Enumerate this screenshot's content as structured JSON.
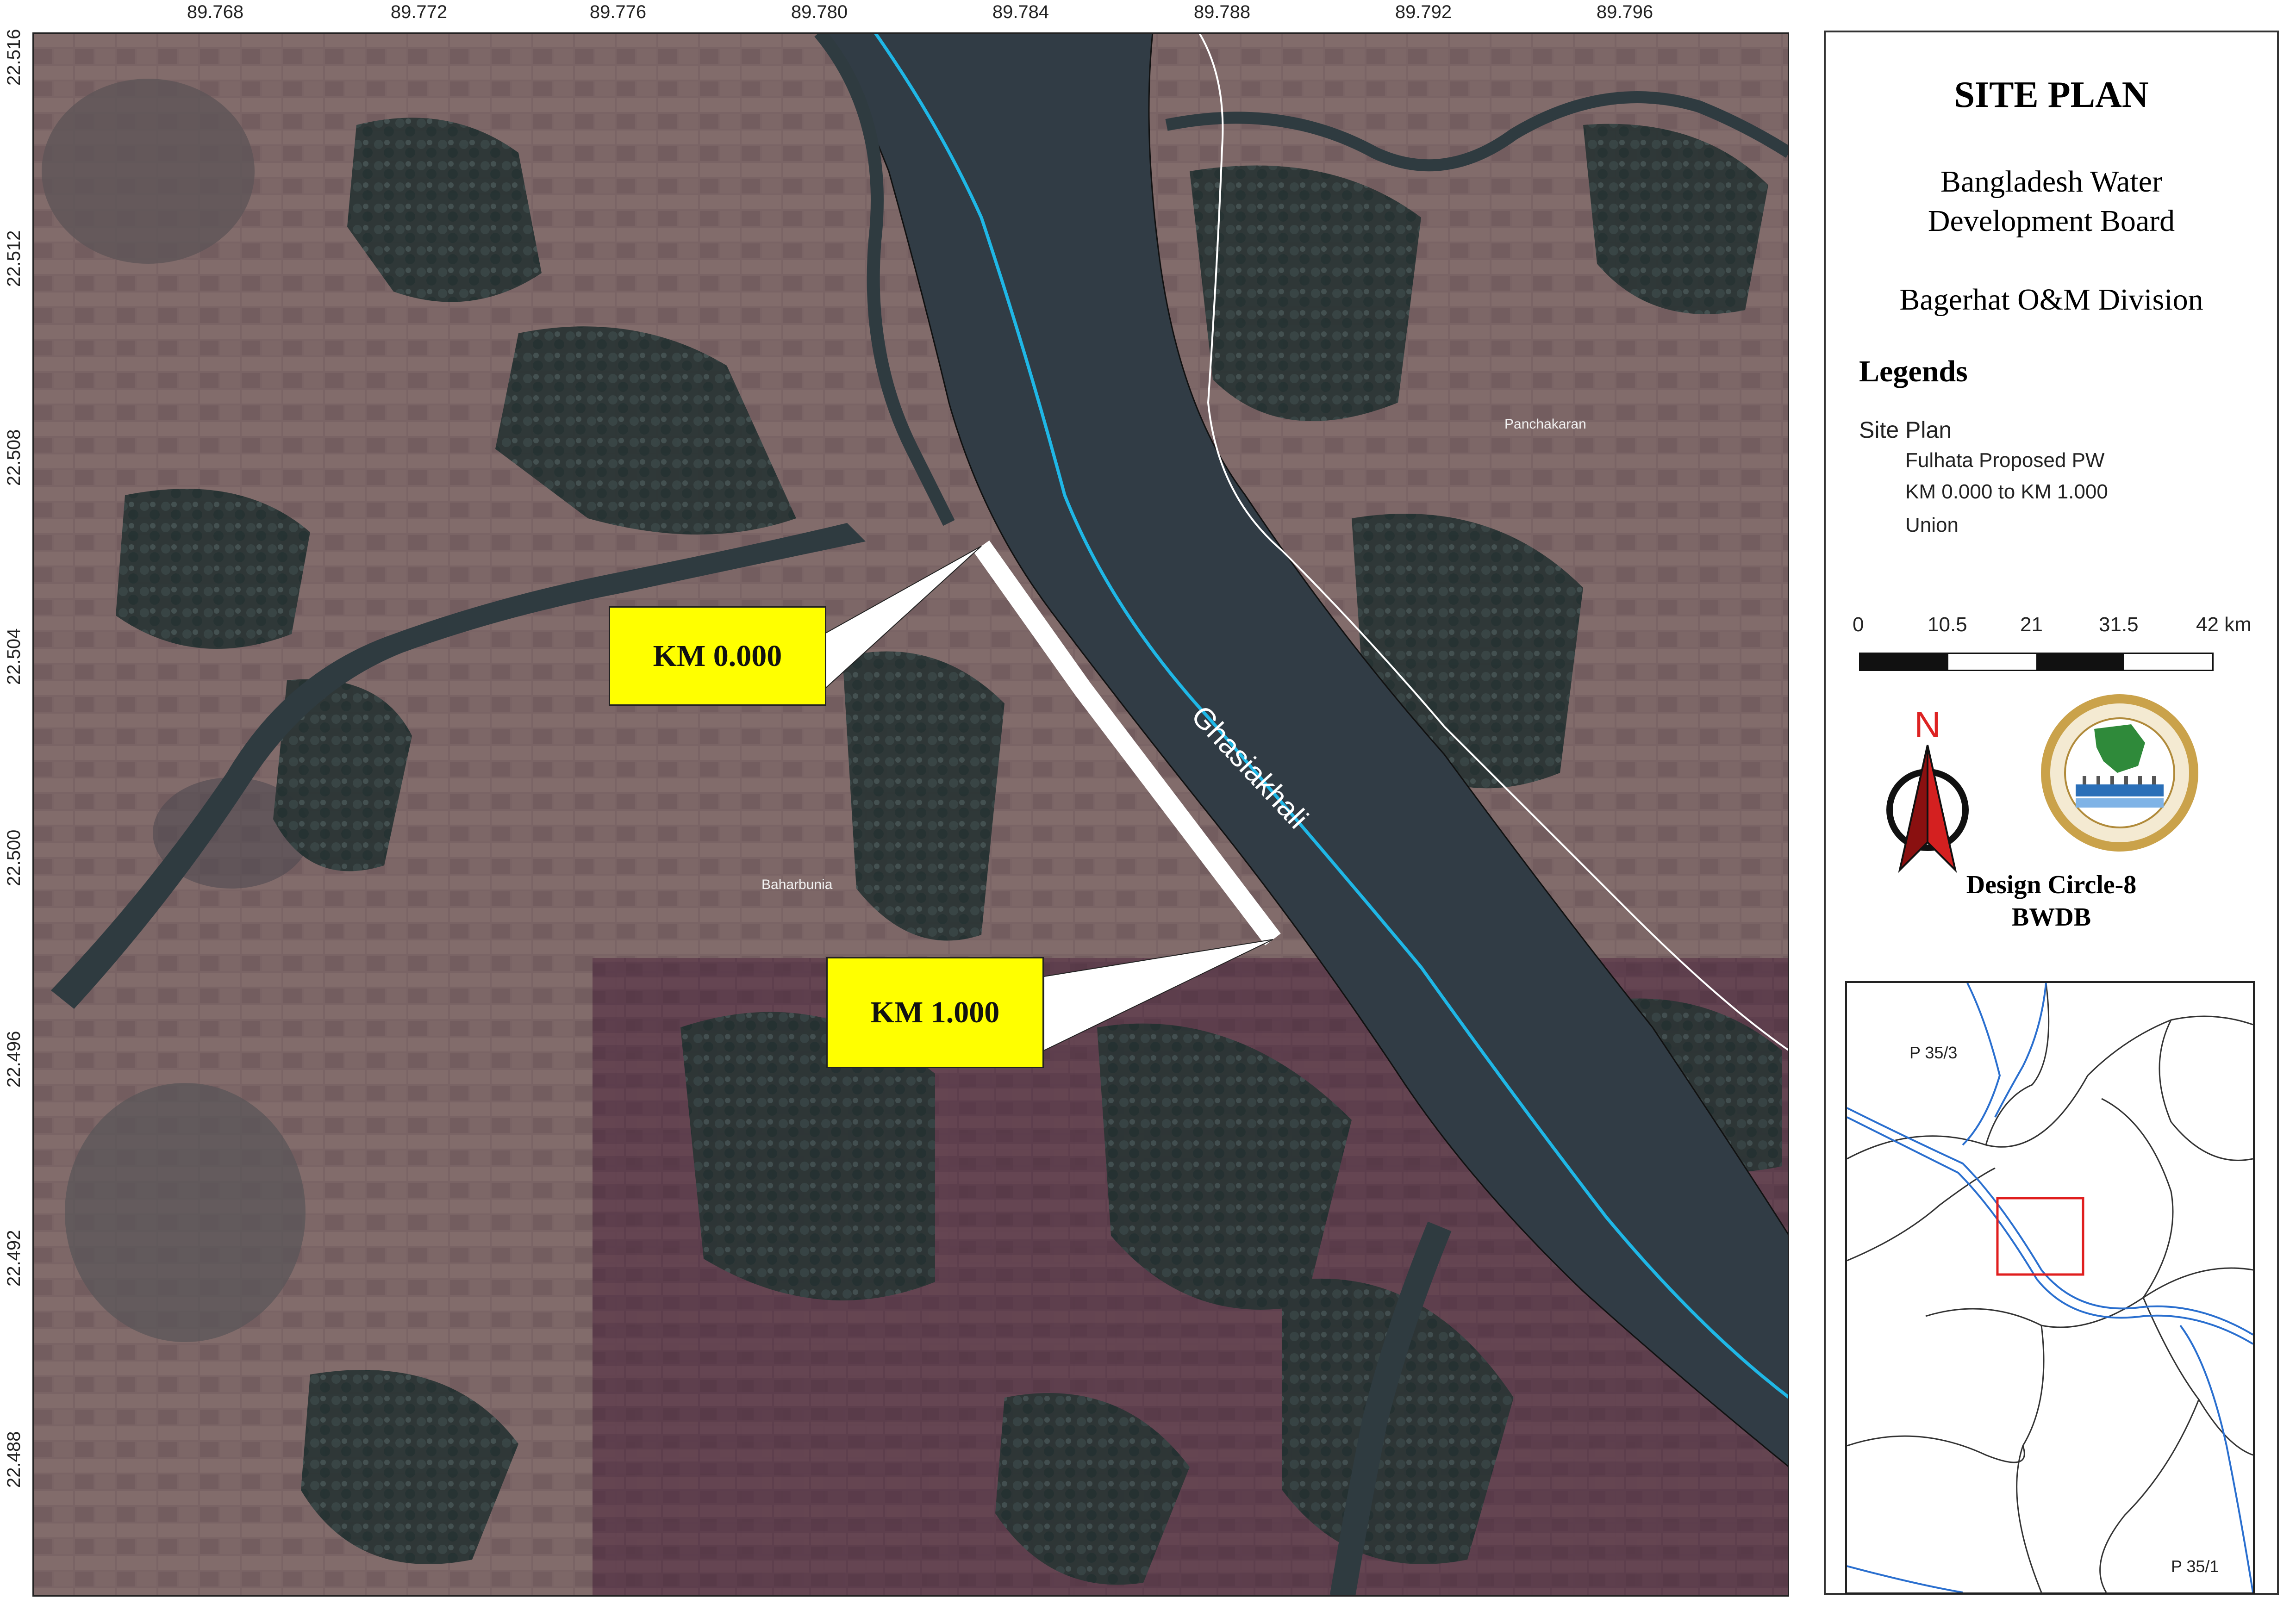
{
  "map": {
    "x_ticks": [
      "89.768",
      "89.772",
      "89.776",
      "89.780",
      "89.784",
      "89.788",
      "89.792",
      "89.796"
    ],
    "y_ticks": [
      "22.516",
      "22.512",
      "22.508",
      "22.504",
      "22.500",
      "22.496",
      "22.492",
      "22.488"
    ],
    "river_label": "Ghasiakhali",
    "places": {
      "panchakaran": "Panchakaran",
      "baharbunia": "Baharbunia"
    },
    "callouts": {
      "start": "KM 0.000",
      "end": "KM 1.000"
    },
    "colors": {
      "highlight": "#ffff00",
      "river_line": "#1fb7e6",
      "road": "#ffffff",
      "proposed_work": "#ffffff"
    }
  },
  "panel": {
    "title": "SITE PLAN",
    "org_line1": "Bangladesh Water",
    "org_line2": "Development Board",
    "division": "Bagerhat O&M Division",
    "legends_heading": "Legends",
    "legend": {
      "group": "Site Plan",
      "item1_line1": "Fulhata Proposed PW",
      "item1_line2": "KM 0.000 to KM 1.000",
      "item2": "Union"
    },
    "scale": {
      "labels": [
        "0",
        "10.5",
        "21",
        "31.5",
        "42 km"
      ]
    },
    "north_letter": "N",
    "north_icon": "north-arrow-icon",
    "logo_icon": "bwdb-logo-icon",
    "design_line1": "Design Circle-8",
    "design_line2": "BWDB",
    "inset": {
      "label_top": "P 35/3",
      "label_bottom": "P 35/1"
    }
  }
}
